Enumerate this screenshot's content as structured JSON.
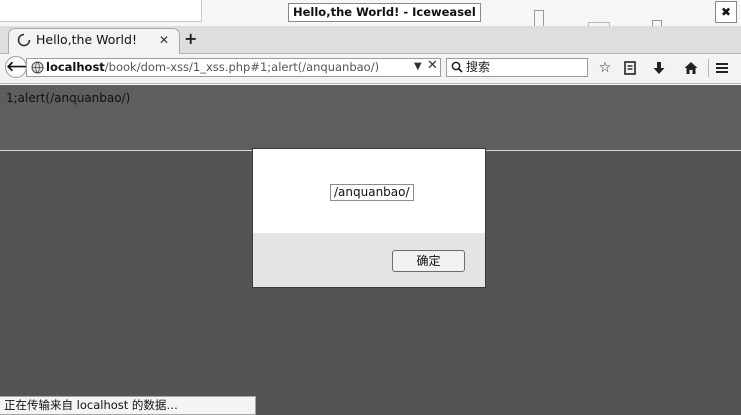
{
  "window": {
    "title": "Hello,the World! - Iceweasel",
    "close_label": "✖"
  },
  "tabs": [
    {
      "label": "Hello,the World!",
      "loading": true
    }
  ],
  "new_tab_label": "+",
  "navbar": {
    "url_host": "localhost",
    "url_path": "/book/dom-xss/1_xss.php#1;alert(/anquanbao/)",
    "search_placeholder": "搜索"
  },
  "page": {
    "text": "1;alert(/anquanbao/)"
  },
  "alert": {
    "message": "/anquanbao/",
    "ok_label": "确定"
  },
  "status": {
    "text": "正在传输来自 localhost 的数据…"
  },
  "icons": {
    "back": "back-arrow-icon",
    "site_identity": "globe-icon",
    "url_dropdown": "chevron-down-icon",
    "stop": "close-icon",
    "search": "search-icon",
    "bookmark": "star-icon",
    "reading_list": "reading-list-icon",
    "downloads": "download-arrow-icon",
    "home": "home-icon",
    "menu": "hamburger-menu-icon"
  },
  "colors": {
    "content_background": "#545454",
    "dialog_background": "#ffffff",
    "chrome_background": "#f3f3f3"
  }
}
